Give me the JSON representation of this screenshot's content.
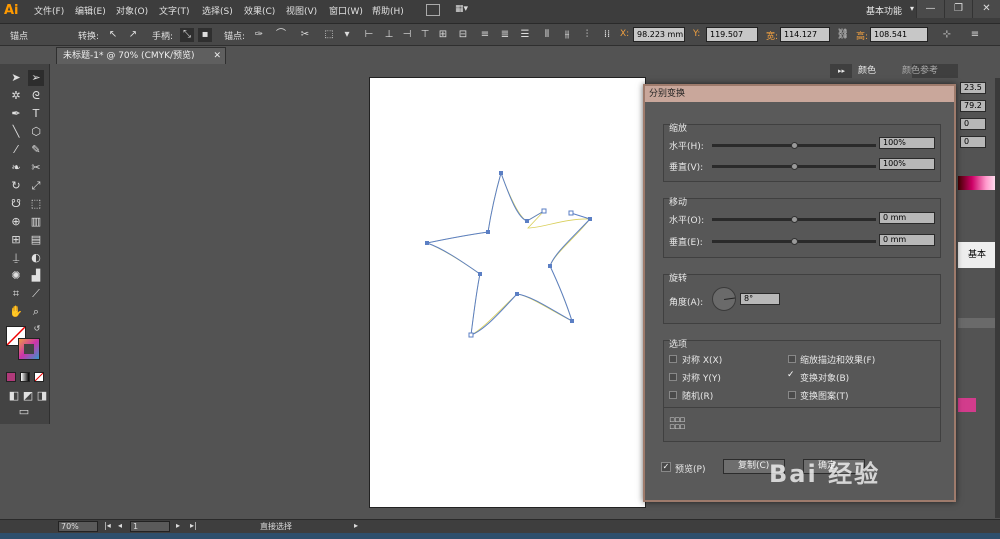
{
  "menubar": {
    "logo": "Ai",
    "items": [
      "文件(F)",
      "编辑(E)",
      "对象(O)",
      "文字(T)",
      "选择(S)",
      "效果(C)",
      "视图(V)",
      "窗口(W)",
      "帮助(H)"
    ],
    "workspace": "基本功能"
  },
  "controlbar": {
    "anchor_label": "锚点",
    "convert_label": "转换:",
    "handles_label": "手柄:",
    "anchor_label2": "锚点:",
    "x_label": "X:",
    "x_value": "98.223 mm",
    "y_label": "Y:",
    "y_value": "119.507",
    "w_label": "宽:",
    "w_value": "114.127",
    "h_label": "高:",
    "h_value": "108.541"
  },
  "document": {
    "tab_title": "未标题-1* @ 70% (CMYK/预览)"
  },
  "panels": {
    "tab_color": "颜色",
    "tab_color_guide": "颜色参考",
    "val1": "23.5",
    "val2": "79.2",
    "val3": "0",
    "val4": "0",
    "basic_label": "基本"
  },
  "dialog": {
    "title": "分别变换",
    "scale": {
      "heading": "缩放",
      "horizontal_label": "水平(H):",
      "horizontal_value": "100%",
      "horizontal_level": 0.5,
      "vertical_label": "垂直(V):",
      "vertical_value": "100%",
      "vertical_level": 0.5
    },
    "move": {
      "heading": "移动",
      "horizontal_label": "水平(O):",
      "horizontal_value": "0 mm",
      "horizontal_level": 0.5,
      "vertical_label": "垂直(E):",
      "vertical_value": "0 mm",
      "vertical_level": 0.5
    },
    "rotate": {
      "heading": "旋转",
      "angle_label": "角度(A):",
      "angle_value": "8°"
    },
    "options": {
      "heading": "选项",
      "reflect_x": "对称 X(X)",
      "reflect_y": "对称 Y(Y)",
      "random": "随机(R)",
      "scale_strokes": "缩放描边和效果(F)",
      "transform_objects": "变换对象(B)",
      "transform_patterns": "变换图案(T)"
    },
    "preview_label": "预览(P)",
    "copy_label": "复制(C)",
    "ok_label": "确定"
  },
  "statusbar": {
    "zoom": "70%",
    "page": "1",
    "tool": "直接选择"
  },
  "watermark": "Bai 经验"
}
